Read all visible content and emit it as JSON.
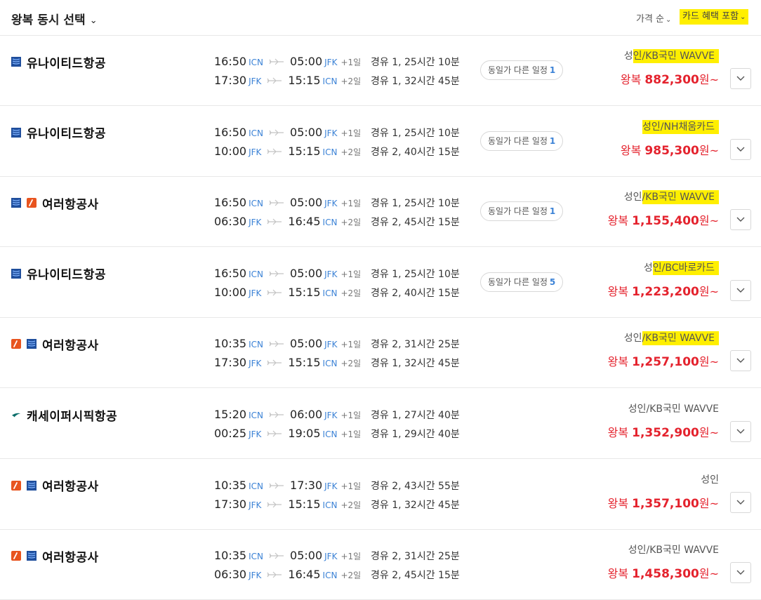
{
  "header": {
    "title": "왕복 동시 선택",
    "sort_label": "가격 순",
    "card_filter_label": "카드 혜택 포함"
  },
  "colors": {
    "accent": "#3b82d6",
    "price": "#e4222d",
    "highlight": "#ffef00"
  },
  "flights": [
    {
      "airline": "유나이티드항공",
      "logos": [
        "united-logo-icon"
      ],
      "legs": [
        {
          "dep_time": "16:50",
          "dep_apt": "ICN",
          "arr_time": "05:00",
          "arr_apt": "JFK",
          "day": "+1일"
        },
        {
          "dep_time": "17:30",
          "dep_apt": "JFK",
          "arr_time": "15:15",
          "arr_apt": "ICN",
          "day": "+2일"
        }
      ],
      "stops": [
        "경유 1, 25시간 10분",
        "경유 1, 32시간 45분"
      ],
      "same_price_label": "동일가 다른 일정",
      "same_price_count": "1",
      "benefit_prefix": "성",
      "benefit_highlight": "인/KB국민 WAVVE",
      "price_prefix": "왕복 ",
      "price": "882,300",
      "price_suffix": "원~"
    },
    {
      "airline": "유나이티드항공",
      "logos": [
        "united-logo-icon"
      ],
      "legs": [
        {
          "dep_time": "16:50",
          "dep_apt": "ICN",
          "arr_time": "05:00",
          "arr_apt": "JFK",
          "day": "+1일"
        },
        {
          "dep_time": "10:00",
          "dep_apt": "JFK",
          "arr_time": "15:15",
          "arr_apt": "ICN",
          "day": "+2일"
        }
      ],
      "stops": [
        "경유 1, 25시간 10분",
        "경유 2, 40시간 15분"
      ],
      "same_price_label": "동일가 다른 일정",
      "same_price_count": "1",
      "benefit_prefix": "",
      "benefit_highlight": "성인/NH채움카드",
      "price_prefix": "왕복 ",
      "price": "985,300",
      "price_suffix": "원~"
    },
    {
      "airline": "여러항공사",
      "logos": [
        "united-logo-icon",
        "jal-logo-icon"
      ],
      "legs": [
        {
          "dep_time": "16:50",
          "dep_apt": "ICN",
          "arr_time": "05:00",
          "arr_apt": "JFK",
          "day": "+1일"
        },
        {
          "dep_time": "06:30",
          "dep_apt": "JFK",
          "arr_time": "16:45",
          "arr_apt": "ICN",
          "day": "+2일"
        }
      ],
      "stops": [
        "경유 1, 25시간 10분",
        "경유 2, 45시간 15분"
      ],
      "same_price_label": "동일가 다른 일정",
      "same_price_count": "1",
      "benefit_prefix": "성인",
      "benefit_highlight": "/KB국민 WAVVE",
      "price_prefix": "왕복 ",
      "price": "1,155,400",
      "price_suffix": "원~"
    },
    {
      "airline": "유나이티드항공",
      "logos": [
        "united-logo-icon"
      ],
      "legs": [
        {
          "dep_time": "16:50",
          "dep_apt": "ICN",
          "arr_time": "05:00",
          "arr_apt": "JFK",
          "day": "+1일"
        },
        {
          "dep_time": "10:00",
          "dep_apt": "JFK",
          "arr_time": "15:15",
          "arr_apt": "ICN",
          "day": "+2일"
        }
      ],
      "stops": [
        "경유 1, 25시간 10분",
        "경유 2, 40시간 15분"
      ],
      "same_price_label": "동일가 다른 일정",
      "same_price_count": "5",
      "benefit_prefix": "성",
      "benefit_highlight": "인/BC바로카드",
      "price_prefix": "왕복 ",
      "price": "1,223,200",
      "price_suffix": "원~"
    },
    {
      "airline": "여러항공사",
      "logos": [
        "jal-logo-icon",
        "united-logo-icon"
      ],
      "legs": [
        {
          "dep_time": "10:35",
          "dep_apt": "ICN",
          "arr_time": "05:00",
          "arr_apt": "JFK",
          "day": "+1일"
        },
        {
          "dep_time": "17:30",
          "dep_apt": "JFK",
          "arr_time": "15:15",
          "arr_apt": "ICN",
          "day": "+2일"
        }
      ],
      "stops": [
        "경유 2, 31시간 25분",
        "경유 1, 32시간 45분"
      ],
      "same_price_label": "",
      "same_price_count": "",
      "benefit_prefix": "성인",
      "benefit_highlight": "/KB국민 WAVVE",
      "price_prefix": "왕복 ",
      "price": "1,257,100",
      "price_suffix": "원~"
    },
    {
      "airline": "캐세이퍼시픽항공",
      "logos": [
        "cathay-logo-icon"
      ],
      "legs": [
        {
          "dep_time": "15:20",
          "dep_apt": "ICN",
          "arr_time": "06:00",
          "arr_apt": "JFK",
          "day": "+1일"
        },
        {
          "dep_time": "00:25",
          "dep_apt": "JFK",
          "arr_time": "19:05",
          "arr_apt": "ICN",
          "day": "+1일"
        }
      ],
      "stops": [
        "경유 1, 27시간 40분",
        "경유 1, 29시간 40분"
      ],
      "same_price_label": "",
      "same_price_count": "",
      "benefit_prefix": "성인/KB국민 WAVVE",
      "benefit_highlight": "",
      "price_prefix": "왕복 ",
      "price": "1,352,900",
      "price_suffix": "원~"
    },
    {
      "airline": "여러항공사",
      "logos": [
        "jal-logo-icon",
        "united-logo-icon"
      ],
      "legs": [
        {
          "dep_time": "10:35",
          "dep_apt": "ICN",
          "arr_time": "17:30",
          "arr_apt": "JFK",
          "day": "+1일"
        },
        {
          "dep_time": "17:30",
          "dep_apt": "JFK",
          "arr_time": "15:15",
          "arr_apt": "ICN",
          "day": "+2일"
        }
      ],
      "stops": [
        "경유 2, 43시간 55분",
        "경유 1, 32시간 45분"
      ],
      "same_price_label": "",
      "same_price_count": "",
      "benefit_prefix": "성인",
      "benefit_highlight": "",
      "price_prefix": "왕복 ",
      "price": "1,357,100",
      "price_suffix": "원~"
    },
    {
      "airline": "여러항공사",
      "logos": [
        "jal-logo-icon",
        "united-logo-icon"
      ],
      "legs": [
        {
          "dep_time": "10:35",
          "dep_apt": "ICN",
          "arr_time": "05:00",
          "arr_apt": "JFK",
          "day": "+1일"
        },
        {
          "dep_time": "06:30",
          "dep_apt": "JFK",
          "arr_time": "16:45",
          "arr_apt": "ICN",
          "day": "+2일"
        }
      ],
      "stops": [
        "경유 2, 31시간 25분",
        "경유 2, 45시간 15분"
      ],
      "same_price_label": "",
      "same_price_count": "",
      "benefit_prefix": "성인/KB국민 WAVVE",
      "benefit_highlight": "",
      "price_prefix": "왕복 ",
      "price": "1,458,300",
      "price_suffix": "원~"
    }
  ]
}
